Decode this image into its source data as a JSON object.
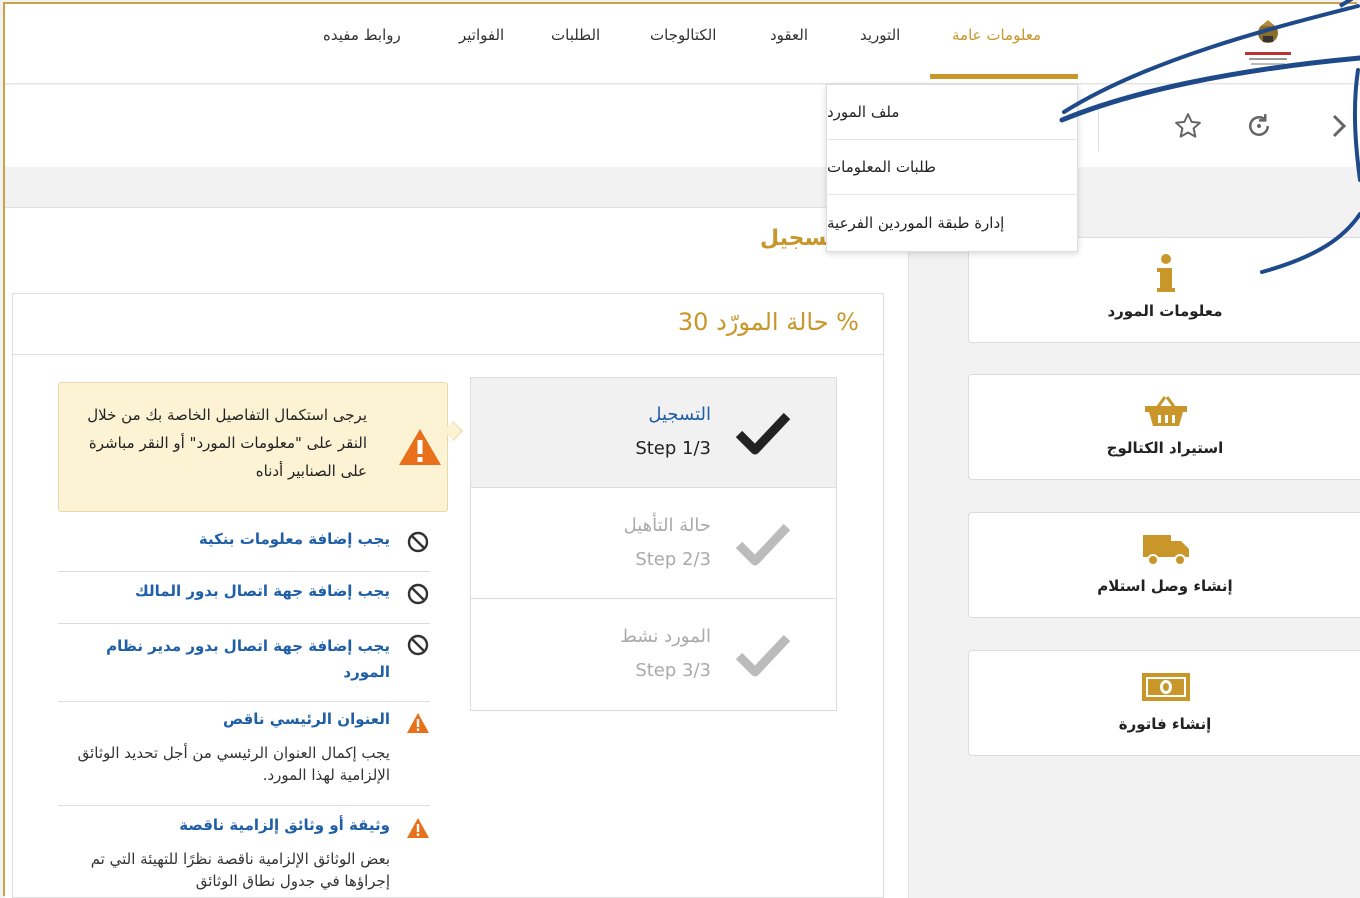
{
  "nav": {
    "items": [
      {
        "label": "معلومات عامة",
        "active": true
      },
      {
        "label": "التوريد"
      },
      {
        "label": "العقود"
      },
      {
        "label": "الكتالوجات"
      },
      {
        "label": "الطلبات"
      },
      {
        "label": "الفواتير"
      },
      {
        "label": "روابط مفيده"
      }
    ],
    "accent_color": "#c9962a"
  },
  "dropdown": {
    "items": [
      "ملف المورد",
      "طلبات المعلومات",
      "إدارة طبقة الموردين الفرعية"
    ]
  },
  "toolbar": {
    "icons": [
      "chevron-right-icon",
      "refresh-icon",
      "star-icon"
    ]
  },
  "page_heading": "تسجيل",
  "cards": [
    {
      "label": "معلومات المورد",
      "icon": "info-icon"
    },
    {
      "label": "استيراد الكتالوج",
      "icon": "basket-icon"
    },
    {
      "label": "إنشاء وصل استلام",
      "icon": "truck-icon"
    },
    {
      "label": "إنشاء فاتورة",
      "icon": "money-icon"
    }
  ],
  "status": {
    "title": "% حالة المورّد 30",
    "percent": 30,
    "steps": [
      {
        "name": "التسجيل",
        "step": "Step 1/3",
        "done": true
      },
      {
        "name": "حالة التأهيل",
        "step": "Step 2/3",
        "done": false
      },
      {
        "name": "المورد نشط",
        "step": "Step 3/3",
        "done": false
      }
    ],
    "notice": "يرجى استكمال التفاصيل الخاصة بك من خلال النقر على \"معلومات المورد\" أو النقر مباشرة على الصنابير أدناه",
    "requirements": [
      {
        "text": "يجب إضافة معلومات بنكية",
        "type": "block"
      },
      {
        "text": "يجب إضافة جهة اتصال بدور المالك",
        "type": "block"
      },
      {
        "text": "يجب إضافة جهة اتصال بدور مدير نظام المورد",
        "type": "block"
      },
      {
        "text": "العنوان الرئيسي ناقص",
        "type": "warning",
        "desc": "يجب إكمال العنوان الرئيسي من أجل تحديد الوثائق الإلزامية لهذا المورد."
      },
      {
        "text": "وثيقة أو وثائق إلزامية ناقصة",
        "type": "warning",
        "desc": "بعض الوثائق الإلزامية ناقصة نظرًا للتهيئة التي تم إجراؤها في جدول نطاق الوثائق"
      }
    ]
  }
}
